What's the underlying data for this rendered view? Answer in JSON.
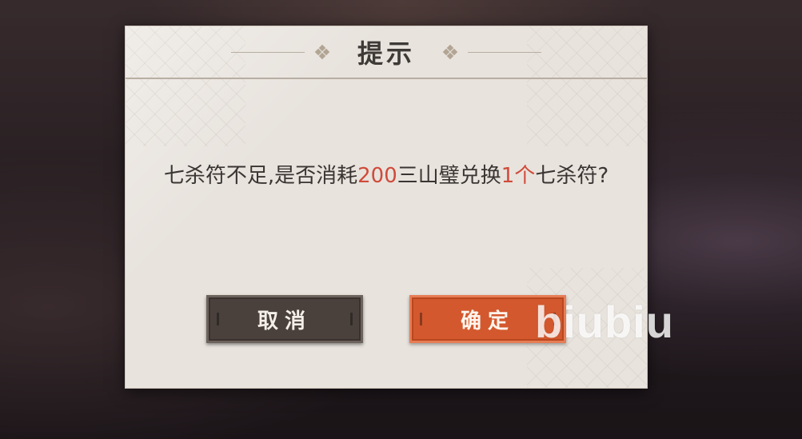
{
  "dialog": {
    "title": "提示",
    "message": {
      "part1": "七杀符不足,是否消耗",
      "cost": "200",
      "part2": "三山璧兑换",
      "quantity": "1个",
      "part3": "七杀符?"
    },
    "buttons": {
      "cancel_label": "取消",
      "confirm_label": "确定"
    }
  },
  "watermark": {
    "text": "biubiu"
  },
  "colors": {
    "highlight": "#d04a3a",
    "confirm_button": "#d3582e",
    "cancel_button": "#4a413d",
    "panel": "#e8e3dd"
  },
  "icons": {
    "title_ornament": "diamond-ornament-icon"
  }
}
